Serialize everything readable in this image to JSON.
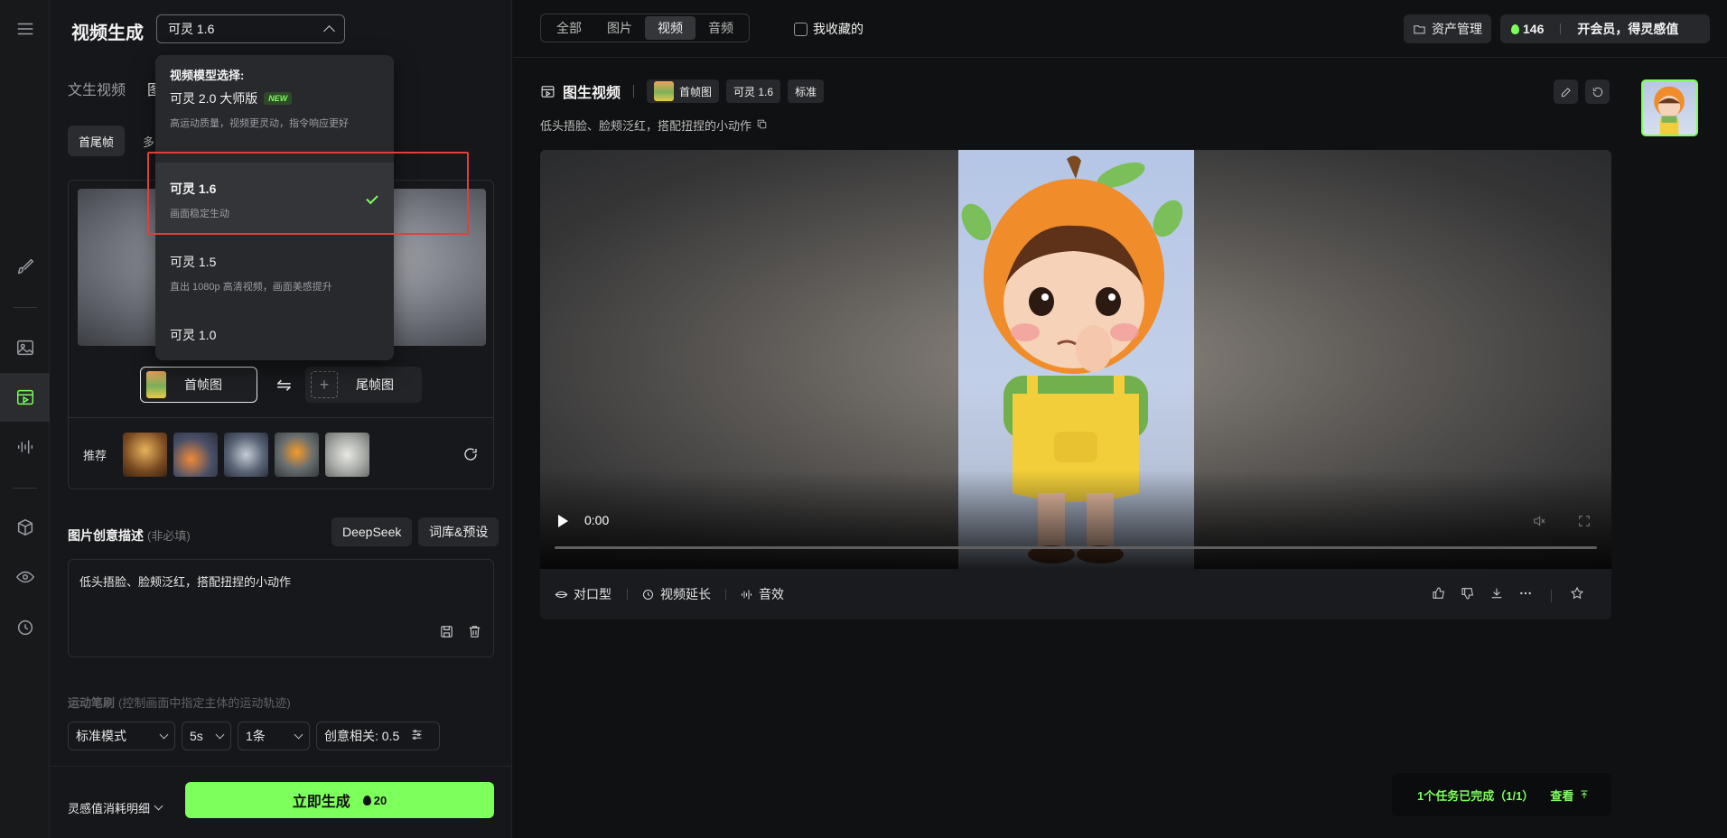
{
  "header": {
    "title": "视频生成",
    "model_selected": "可灵 1.6"
  },
  "panel": {
    "tabs": [
      {
        "label": "文生视频",
        "active": false
      },
      {
        "label": "图",
        "active": true
      }
    ],
    "subtabs": [
      {
        "label": "首尾帧",
        "active": true
      },
      {
        "label": "多",
        "active": false
      }
    ],
    "first_frame_label": "首帧图",
    "last_frame_label": "尾帧图",
    "swap_glyph": "⇋",
    "recommend_label": "推荐",
    "prompt_label": "图片创意描述",
    "prompt_optional": "(非必填)",
    "deepseek_label": "DeepSeek",
    "presets_label": "词库&预设",
    "prompt_text": "低头捂脸、脸颊泛红，搭配扭捏的小动作",
    "motion_label": "运动笔刷",
    "motion_hint": "(控制画面中指定主体的运动轨迹)",
    "mode_select": "标准模式",
    "duration_select": "5s",
    "count_select": "1条",
    "creativity_label": "创意相关: 0.5",
    "cost_detail_label": "灵感值消耗明细",
    "generate_label": "立即生成",
    "generate_cost": "20"
  },
  "dropdown": {
    "header": "视频模型选择:",
    "items": [
      {
        "name": "可灵 2.0 大师版",
        "badge": "NEW",
        "desc": "高运动质量，视频更灵动，指令响应更好",
        "selected": false
      },
      {
        "name": "可灵 1.6",
        "badge": "",
        "desc": "画面稳定生动",
        "selected": true
      },
      {
        "name": "可灵 1.5",
        "badge": "",
        "desc": "直出 1080p 高清视频，画面美感提升",
        "selected": false
      },
      {
        "name": "可灵 1.0",
        "badge": "",
        "desc": "",
        "selected": false
      }
    ]
  },
  "topbar": {
    "filters": [
      {
        "label": "全部",
        "active": false
      },
      {
        "label": "图片",
        "active": false
      },
      {
        "label": "视频",
        "active": true
      },
      {
        "label": "音频",
        "active": false
      }
    ],
    "favorites_label": "我收藏的",
    "asset_label": "资产管理",
    "credits": "146",
    "member_label": "开会员，得灵感值"
  },
  "content": {
    "title": "图生视频",
    "tag_first_frame": "首帧图",
    "tag_model": "可灵 1.6",
    "tag_quality": "标准",
    "subtitle": "低头捂脸、脸颊泛红，搭配扭捏的小动作",
    "video_time": "0:00",
    "actions": {
      "lip_sync": "对口型",
      "extend": "视频延长",
      "sound": "音效"
    }
  },
  "toast": {
    "text": "1个任务已完成（1/1）",
    "view_label": "查看"
  },
  "colors": {
    "accent": "#7dff5c",
    "highlight": "#e0403a",
    "background": "#101112"
  }
}
